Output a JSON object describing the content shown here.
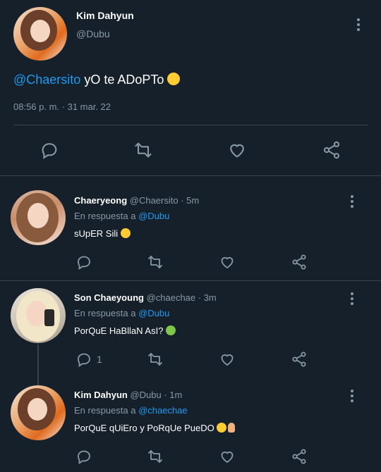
{
  "main_tweet": {
    "name": "Kim Dahyun",
    "handle": "@Dubu",
    "mention": "@Chaersito",
    "text": " yO te ADoPTo ",
    "timestamp": "08:56 p. m. · 31 mar. 22"
  },
  "replies": [
    {
      "name": "Chaeryeong",
      "meta": " @Chaersito · 5m",
      "reply_prefix": "En respuesta a ",
      "reply_to": "@Dubu",
      "text": "sUpER Sili ",
      "reply_count": ""
    },
    {
      "name": "Son Chaeyoung",
      "meta": " @chaechae · 3m",
      "reply_prefix": "En respuesta a ",
      "reply_to": "@Dubu",
      "text": "PorQuE HaBllaN AsI? ",
      "reply_count": "1"
    },
    {
      "name": "Kim Dahyun",
      "meta": " @Dubu · 1m",
      "reply_prefix": "En respuesta a ",
      "reply_to": "@chaechae",
      "text": "PorQuE qUiEro y PoRqUe PueDO ",
      "reply_count": ""
    }
  ],
  "icons": [
    "reply-icon",
    "retweet-icon",
    "like-icon",
    "share-icon",
    "more-icon"
  ],
  "colors": {
    "background": "#15202b",
    "accent": "#1d9bf0",
    "muted": "#8899a6",
    "divider": "#38444d"
  }
}
